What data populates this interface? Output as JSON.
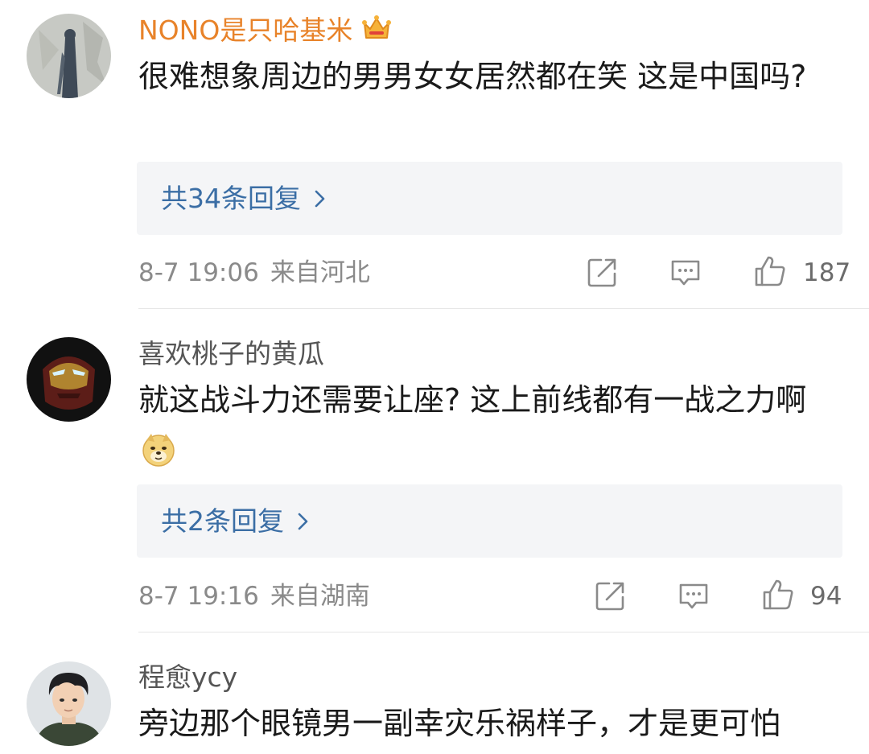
{
  "comments": [
    {
      "username": "NONO是只哈基米",
      "user_badge_icon": "crown-badge-icon",
      "vip": true,
      "text": "很难想象周边的男男女女居然都在笑 这是中国吗?",
      "replies_label": "共34条回复",
      "time": "8-7 19:06",
      "location": "来自河北",
      "likes": "187"
    },
    {
      "username": "喜欢桃子的黄瓜",
      "vip": false,
      "text": "就这战斗力还需要让座? 这上前线都有一战之力啊",
      "emoji_icon": "doge-emoji-icon",
      "replies_label": "共2条回复",
      "time": "8-7 19:16",
      "location": "来自湖南",
      "likes": "94"
    },
    {
      "username": "程愈ycy",
      "vip": false,
      "text": "旁边那个眼镜男一副幸灾乐祸样子，才是更可怕"
    }
  ],
  "icons": {
    "share": "share-icon",
    "comment": "comment-icon",
    "like": "thumbs-up-icon",
    "reply_chevron": "chevron-right-icon"
  },
  "colors": {
    "vip_username": "#e8832a",
    "username": "#555555",
    "reply_link": "#3b6ea5",
    "reply_bg": "#f4f5f7",
    "meta": "#8a8a8a"
  }
}
